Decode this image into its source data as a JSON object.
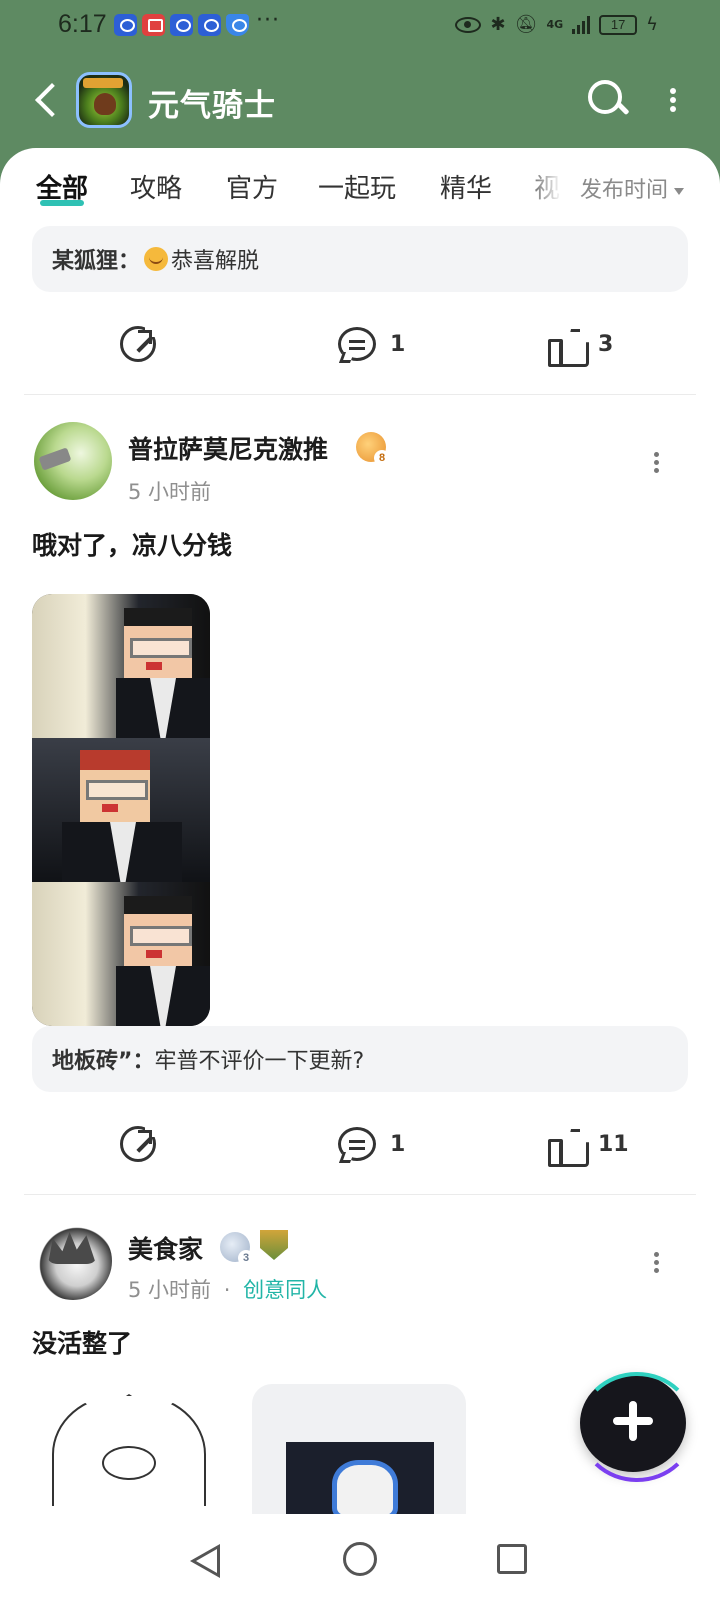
{
  "status_bar": {
    "time": "6:17",
    "more": "···",
    "network": "4G",
    "battery": "17"
  },
  "header": {
    "title": "元气骑士",
    "back_icon": "back-arrow-icon",
    "search_icon": "search-icon",
    "more_icon": "more-vertical-icon"
  },
  "tabs": {
    "items": [
      "全部",
      "攻略",
      "官方",
      "一起玩",
      "精华",
      "视"
    ],
    "active": "全部",
    "accent_color": "#2fc1b4",
    "sort_label": "发布时间"
  },
  "posts": [
    {
      "comment": {
        "author": "某狐狸：",
        "text": "恭喜解脱",
        "emoji": "emoji-icon"
      },
      "actions": {
        "comments": "1",
        "likes": "3"
      }
    },
    {
      "author": "普拉萨莫尼克激推",
      "level_badge": "8",
      "time": "5 小时前",
      "text": "哦对了，凉八分钱",
      "image_captions": [
        "",
        "",
        ""
      ],
      "comment": {
        "author": "地板砖”：",
        "text": "牢普不评价一下更新?"
      },
      "actions": {
        "comments": "1",
        "likes": "11"
      }
    },
    {
      "author": "美食家",
      "level_badge": "3",
      "time": "5 小时前",
      "separator": "·",
      "category": "创意同人",
      "text": "没活整了"
    }
  ],
  "fab": {
    "icon": "plus-icon"
  },
  "navbar": {
    "back": "nav-back-icon",
    "home": "nav-home-icon",
    "recent": "nav-recent-icon"
  },
  "colors": {
    "header_bg": "#5e8a62",
    "accent": "#2fc1b4"
  }
}
